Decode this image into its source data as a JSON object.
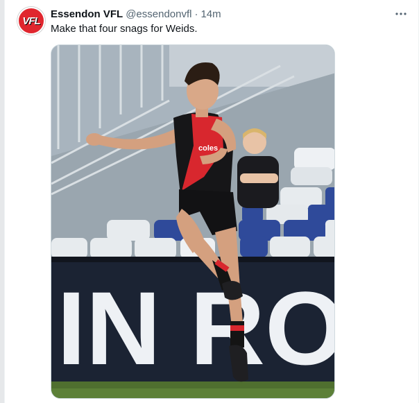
{
  "tweet": {
    "display_name": "Essendon VFL",
    "handle": "@essendonvfl",
    "separator": "·",
    "time": "14m",
    "text": "Make that four snags for Weids.",
    "avatar_logo": "VFL"
  },
  "media": {
    "signage_text": "IN ROUN",
    "jumper_sponsor": "coles"
  },
  "icons": {
    "more": "more-horizontal-icon"
  },
  "colors": {
    "essendon_red": "#e0262e",
    "text_primary": "#0f1419",
    "text_secondary": "#536471"
  }
}
